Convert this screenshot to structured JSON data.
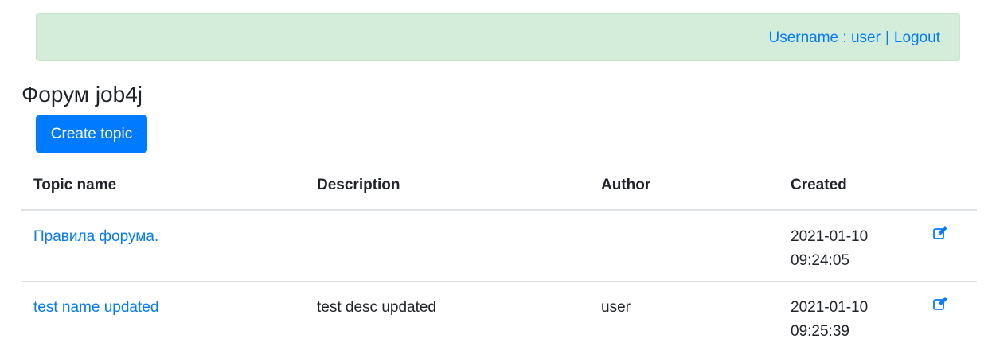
{
  "header": {
    "username_label": "Username : user",
    "separator": "|",
    "logout_label": "Logout"
  },
  "page": {
    "title": "Форум job4j",
    "create_button_label": "Create topic"
  },
  "table": {
    "columns": [
      "Topic name",
      "Description",
      "Author",
      "Created"
    ],
    "rows": [
      {
        "name": "Правила форума.",
        "description": "",
        "author": "",
        "created_date": "2021-01-10",
        "created_time": "09:24:05",
        "action_icon": "edit-icon"
      },
      {
        "name": "test name updated",
        "description": "test desc updated",
        "author": "user",
        "created_date": "2021-01-10",
        "created_time": "09:25:39",
        "action_icon": "edit-icon"
      }
    ]
  },
  "colors": {
    "accent": "#007bff",
    "alert_bg": "#d4edda",
    "alert_border": "#c3e6cb"
  }
}
